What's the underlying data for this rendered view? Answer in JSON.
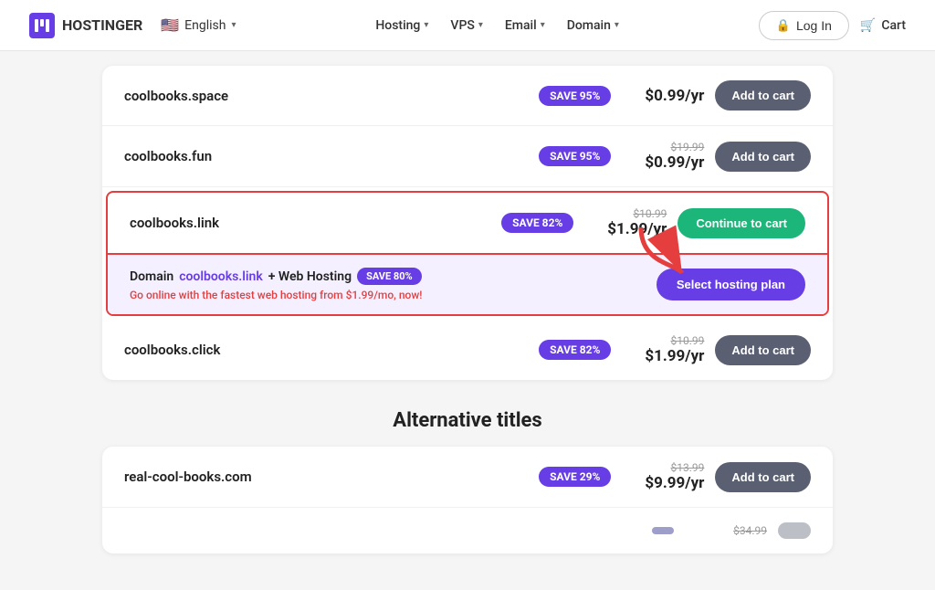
{
  "navbar": {
    "logo_text": "HOSTINGER",
    "logo_initial": "H",
    "lang_flag": "🇺🇸",
    "lang_label": "English",
    "nav_items": [
      {
        "label": "Hosting",
        "has_chevron": true
      },
      {
        "label": "VPS",
        "has_chevron": true
      },
      {
        "label": "Email",
        "has_chevron": true
      },
      {
        "label": "Domain",
        "has_chevron": true
      }
    ],
    "login_label": "Log In",
    "cart_label": "Cart"
  },
  "domain_results": {
    "rows": [
      {
        "name": "coolbooks.space",
        "badge": "SAVE 95%",
        "old_price": "",
        "new_price": "$0.99/yr",
        "btn_label": "Add to cart",
        "btn_type": "add",
        "highlighted": false,
        "show_bundle": false
      },
      {
        "name": "coolbooks.fun",
        "badge": "SAVE 95%",
        "old_price": "$19.99",
        "new_price": "$0.99/yr",
        "btn_label": "Add to cart",
        "btn_type": "add",
        "highlighted": false,
        "show_bundle": false
      },
      {
        "name": "coolbooks.link",
        "badge": "SAVE 82%",
        "old_price": "$10.99",
        "new_price": "$1.99/yr",
        "btn_label": "Continue to cart",
        "btn_type": "continue",
        "highlighted": true,
        "show_bundle": true
      },
      {
        "name": "coolbooks.click",
        "badge": "SAVE 82%",
        "old_price": "$10.99",
        "new_price": "$1.99/yr",
        "btn_label": "Add to cart",
        "btn_type": "add",
        "highlighted": false,
        "show_bundle": false
      }
    ],
    "bundle": {
      "prefix": "Domain ",
      "domain_link": "coolbooks.link",
      "suffix": " + Web Hosting",
      "badge": "SAVE 80%",
      "subtitle": "Go online with the fastest web hosting from $1.99/mo, now!",
      "btn_label": "Select hosting plan"
    }
  },
  "alternative_section": {
    "title": "Alternative titles",
    "rows": [
      {
        "name": "real-cool-books.com",
        "badge": "SAVE 29%",
        "old_price": "$13.99",
        "new_price": "$9.99/yr",
        "btn_label": "Add to cart"
      },
      {
        "name": "",
        "badge": "",
        "old_price": "$34.99",
        "new_price": "",
        "btn_label": ""
      }
    ]
  }
}
